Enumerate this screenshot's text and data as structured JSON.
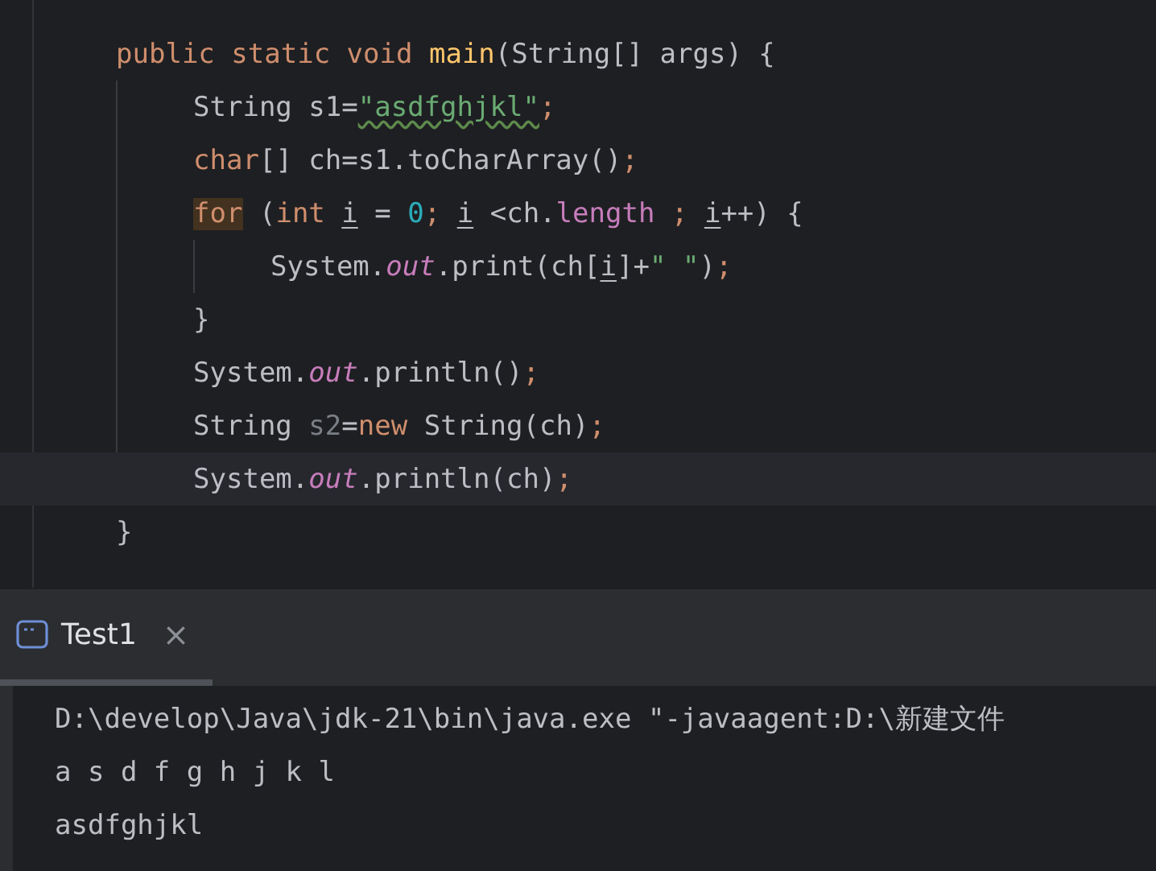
{
  "editor": {
    "lines": [
      {
        "current": false,
        "tokens": [
          {
            "kind": "keyword",
            "text": "public static void "
          },
          {
            "kind": "decl",
            "text": "main"
          },
          {
            "kind": "plain",
            "text": "(String[] args) {"
          }
        ],
        "children": [
          {
            "current": false,
            "tokens": [
              {
                "kind": "plain",
                "text": "String s1="
              },
              {
                "kind": "string-typo",
                "text": "\"asdfghjkl\""
              },
              {
                "kind": "semi",
                "text": ";"
              }
            ]
          },
          {
            "current": false,
            "tokens": [
              {
                "kind": "keyword",
                "text": "char"
              },
              {
                "kind": "plain",
                "text": "[] ch=s1.toCharArray()"
              },
              {
                "kind": "semi",
                "text": ";"
              }
            ]
          },
          {
            "current": false,
            "tokens": [
              {
                "kind": "keyword-marked",
                "text": "for"
              },
              {
                "kind": "plain",
                "text": " ("
              },
              {
                "kind": "keyword",
                "text": "int "
              },
              {
                "kind": "var",
                "text": "i"
              },
              {
                "kind": "plain",
                "text": " = "
              },
              {
                "kind": "number",
                "text": "0"
              },
              {
                "kind": "semi",
                "text": "; "
              },
              {
                "kind": "var",
                "text": "i"
              },
              {
                "kind": "plain",
                "text": " <ch."
              },
              {
                "kind": "field",
                "text": "length"
              },
              {
                "kind": "semi",
                "text": " ; "
              },
              {
                "kind": "var",
                "text": "i"
              },
              {
                "kind": "plain",
                "text": "++) {"
              }
            ],
            "children": [
              {
                "current": false,
                "tokens": [
                  {
                    "kind": "plain",
                    "text": "System."
                  },
                  {
                    "kind": "static",
                    "text": "out"
                  },
                  {
                    "kind": "plain",
                    "text": ".print(ch["
                  },
                  {
                    "kind": "var",
                    "text": "i"
                  },
                  {
                    "kind": "plain",
                    "text": "]+"
                  },
                  {
                    "kind": "string",
                    "text": "\" \""
                  },
                  {
                    "kind": "plain",
                    "text": ")"
                  },
                  {
                    "kind": "semi",
                    "text": ";"
                  }
                ]
              }
            ]
          },
          {
            "current": false,
            "tokens": [
              {
                "kind": "plain",
                "text": "}"
              }
            ]
          },
          {
            "current": false,
            "tokens": [
              {
                "kind": "plain",
                "text": "System."
              },
              {
                "kind": "static",
                "text": "out"
              },
              {
                "kind": "plain",
                "text": ".println()"
              },
              {
                "kind": "semi",
                "text": ";"
              }
            ]
          },
          {
            "current": false,
            "tokens": [
              {
                "kind": "plain",
                "text": "String "
              },
              {
                "kind": "unused",
                "text": "s2"
              },
              {
                "kind": "plain",
                "text": "="
              },
              {
                "kind": "keyword",
                "text": "new "
              },
              {
                "kind": "plain",
                "text": "String(ch)"
              },
              {
                "kind": "semi",
                "text": ";"
              }
            ]
          },
          {
            "current": true,
            "tokens": [
              {
                "kind": "plain",
                "text": "System."
              },
              {
                "kind": "static",
                "text": "out"
              },
              {
                "kind": "plain",
                "text": ".println(ch)"
              },
              {
                "kind": "semi",
                "text": ";"
              }
            ]
          }
        ]
      },
      {
        "current": false,
        "tokens": [
          {
            "kind": "plain",
            "text": "}"
          }
        ]
      }
    ]
  },
  "run_panel": {
    "tabs": [
      {
        "label": "Test1",
        "selected": true,
        "close": "×"
      }
    ],
    "console": [
      "D:\\develop\\Java\\jdk-21\\bin\\java.exe \"-javaagent:D:\\新建文件",
      "a s d f g h j k l",
      "asdfghjkl"
    ]
  }
}
